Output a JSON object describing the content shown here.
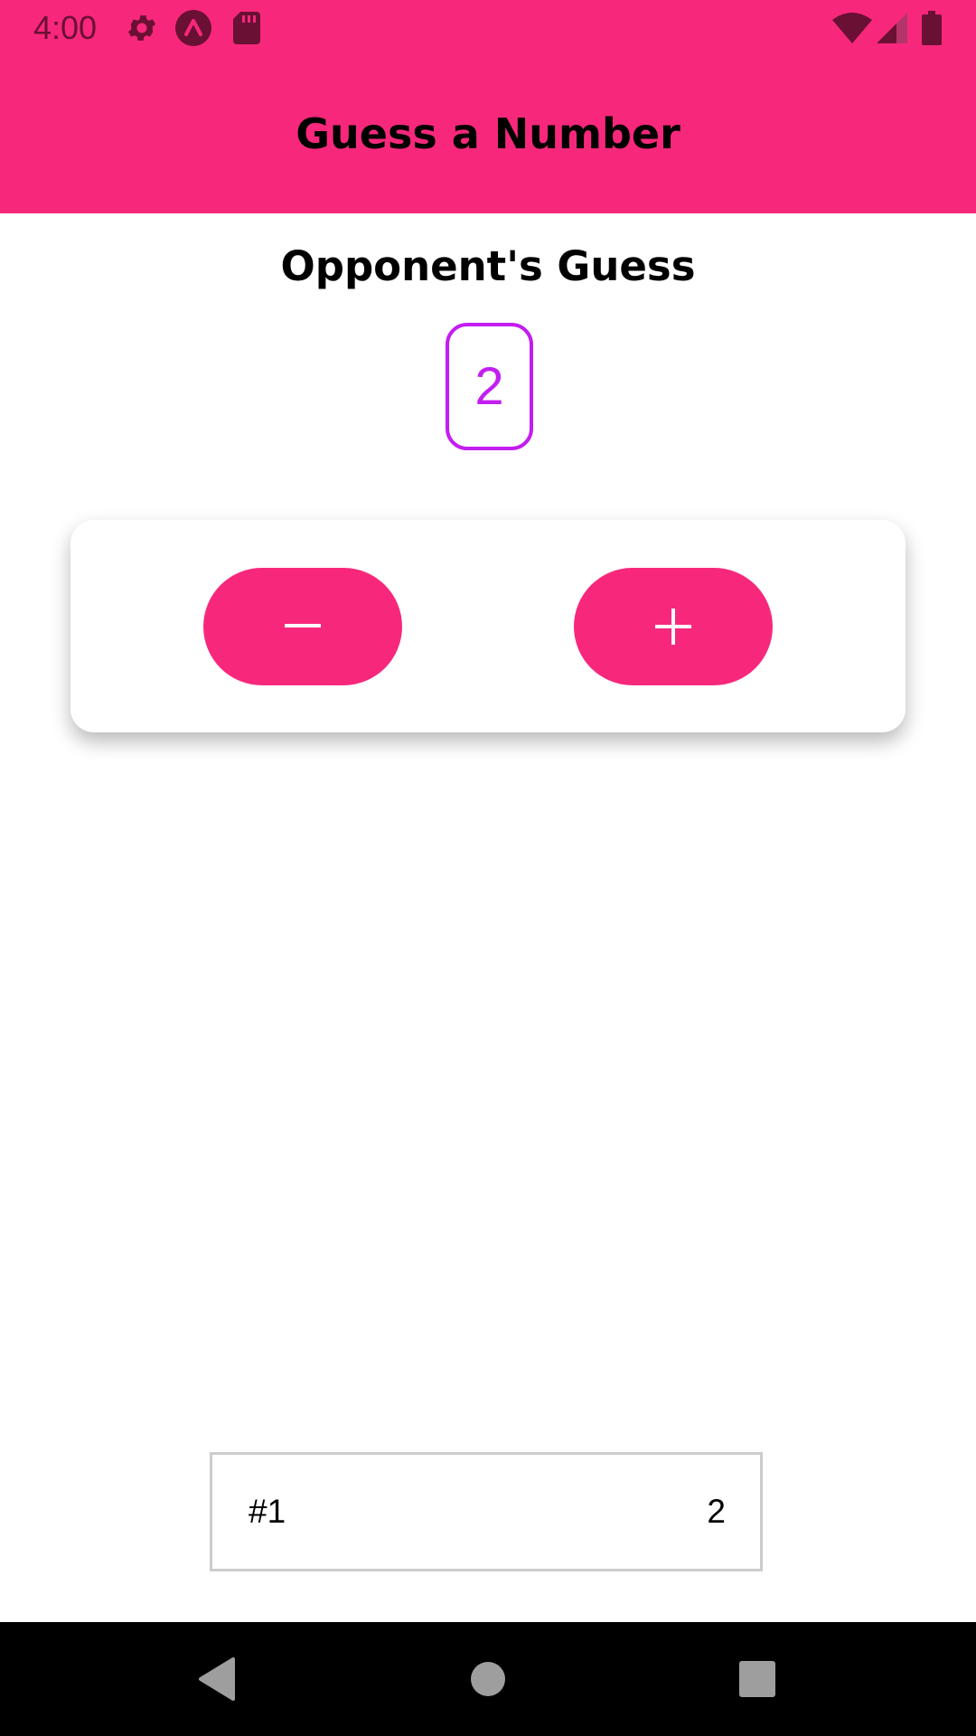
{
  "status_bar": {
    "time": "4:00",
    "icons": [
      "settings-icon",
      "expo-icon",
      "sd-card-icon",
      "wifi-icon",
      "signal-icon",
      "battery-icon"
    ]
  },
  "header": {
    "title": "Guess a Number"
  },
  "main": {
    "section_title": "Opponent's Guess",
    "current_guess": "2",
    "lower_button_label": "–",
    "higher_button_label": "+"
  },
  "guess_log": [
    {
      "round": "#1",
      "value": "2"
    }
  ],
  "nav_bar": {
    "buttons": [
      "back-icon",
      "home-icon",
      "recents-icon"
    ]
  },
  "colors": {
    "accent": "#f7287b",
    "guess_border": "#c31ef0",
    "status_text": "#6a1034"
  }
}
